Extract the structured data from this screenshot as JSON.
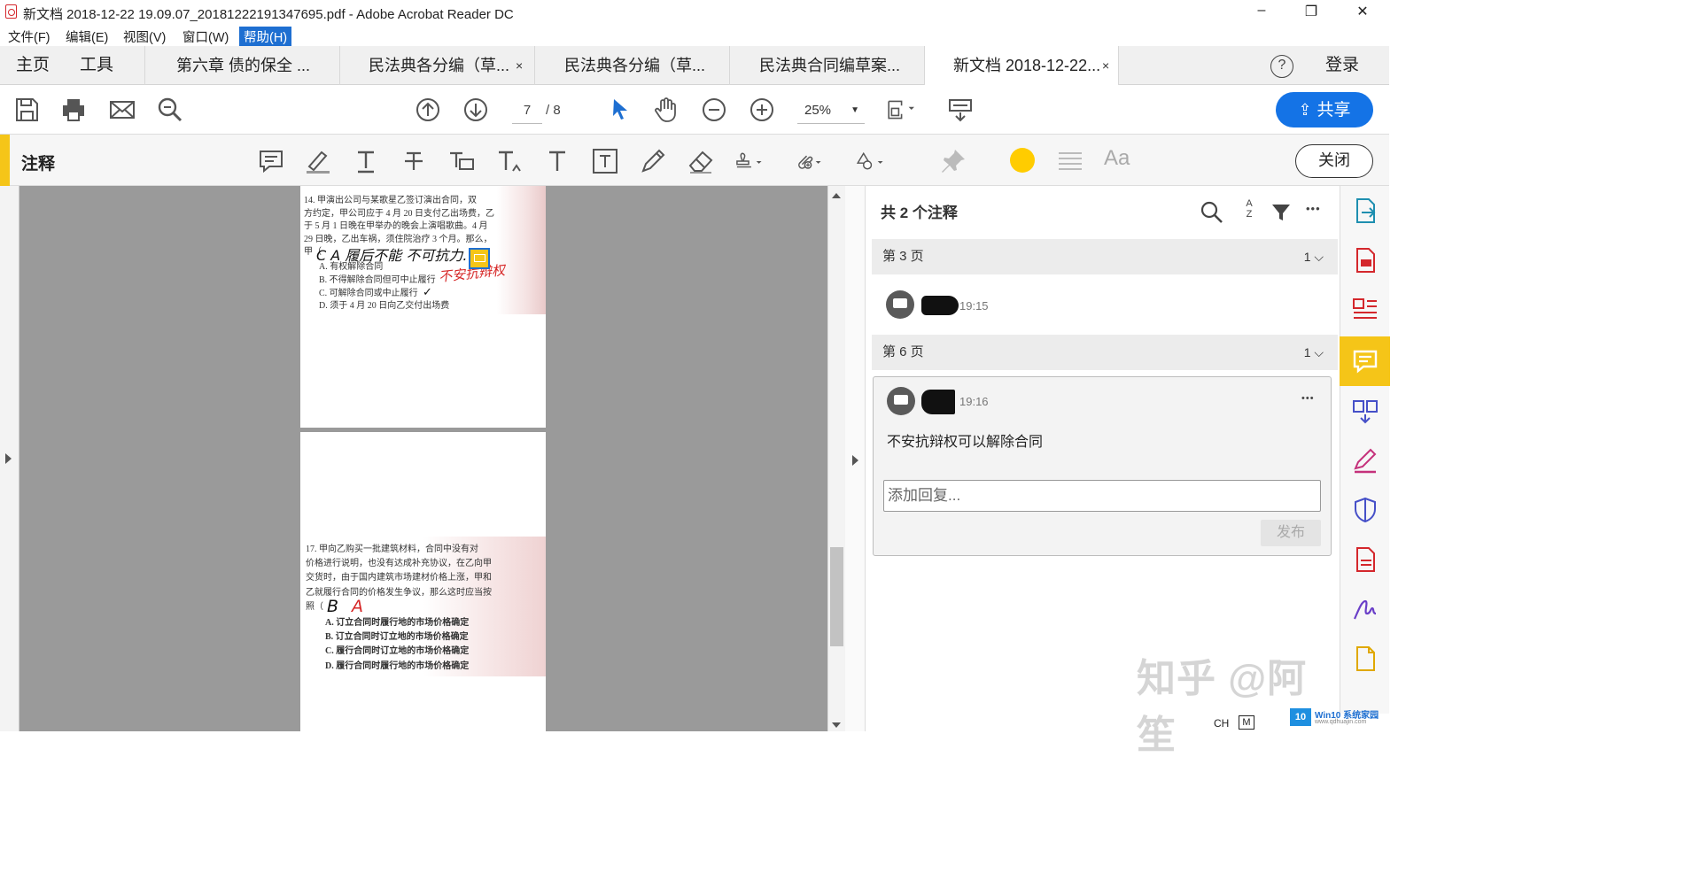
{
  "window": {
    "title": "新文档 2018-12-22 19.09.07_20181222191347695.pdf - Adobe Acrobat Reader DC",
    "minimize": "–",
    "restore": "❐",
    "close": "✕"
  },
  "menubar": [
    "文件(F)",
    "编辑(E)",
    "视图(V)",
    "窗口(W)",
    "帮助(H)"
  ],
  "tabs": {
    "home": "主页",
    "tools": "工具",
    "docs": [
      {
        "label": "第六章 债的保全 ...",
        "closable": false
      },
      {
        "label": "民法典各分编（草...",
        "closable": true
      },
      {
        "label": "民法典各分编（草...",
        "closable": false
      },
      {
        "label": "民法典合同编草案...",
        "closable": false
      },
      {
        "label": "新文档 2018-12-22...",
        "closable": true,
        "active": true
      }
    ],
    "close_glyph": "×",
    "help_icon": "?",
    "login": "登录"
  },
  "toolbar": {
    "page_current": "7",
    "page_total": "/ 8",
    "zoom": "25%",
    "share": "共享"
  },
  "comment_bar": {
    "label": "注释",
    "font_button": "Aa",
    "close": "关闭",
    "accent_color": "#f5c518",
    "color_swatch": "#ffcc00"
  },
  "document": {
    "page_top": {
      "lines": [
        "14. 甲演出公司与某歌星乙签订演出合同，双",
        "方约定，甲公司应于 4 月 20 日支付乙出场费，乙",
        "于 5 月 1 日晚在甲举办的晚会上演唱歌曲。4 月",
        "29 日晚，乙出车祸，须住院治疗 3 个月。那么，",
        "甲（"
      ],
      "options": [
        "A. 有权解除合同",
        "B. 不得解除合同但可中止履行",
        "C. 可解除合同或中止履行",
        "D. 须于 4 月 20 日向乙交付出场费"
      ],
      "handwriting_black": "C A 履后不能  不可抗力.",
      "handwriting_red": "不安抗辩权",
      "check": "✓"
    },
    "page_bottom": {
      "lines": [
        "17. 甲向乙购买一批建筑材料，合同中没有对",
        "价格进行说明，也没有达成补充协议，在乙向甲",
        "交货时，由于国内建筑市场建材价格上涨，甲和",
        "乙就履行合同的价格发生争议，那么这时应当按",
        "照（"
      ],
      "handwriting_black": "B",
      "handwriting_red": "A",
      "options": [
        "A. 订立合同时履行地的市场价格确定",
        "B. 订立合同时订立地的市场价格确定",
        "C. 履行合同时订立地的市场价格确定",
        "D. 履行合同时履行地的市场价格确定"
      ]
    }
  },
  "panel": {
    "header": "共 2 个注释",
    "sort_label": "A Z",
    "more": "•••",
    "groups": [
      {
        "page": "第 3 页",
        "count": "1",
        "time": "19:15"
      },
      {
        "page": "第 6 页",
        "count": "1",
        "time": "19:16",
        "text": "不安抗辩权可以解除合同"
      }
    ],
    "reply_placeholder": "添加回复...",
    "post": "发布"
  },
  "watermark": {
    "text": "知乎 @阿笙",
    "badge": "Win10 系统家园",
    "badge_url": "www.qdhuajin.com"
  },
  "taskbar": {
    "ime": "CH",
    "mode": "M"
  }
}
